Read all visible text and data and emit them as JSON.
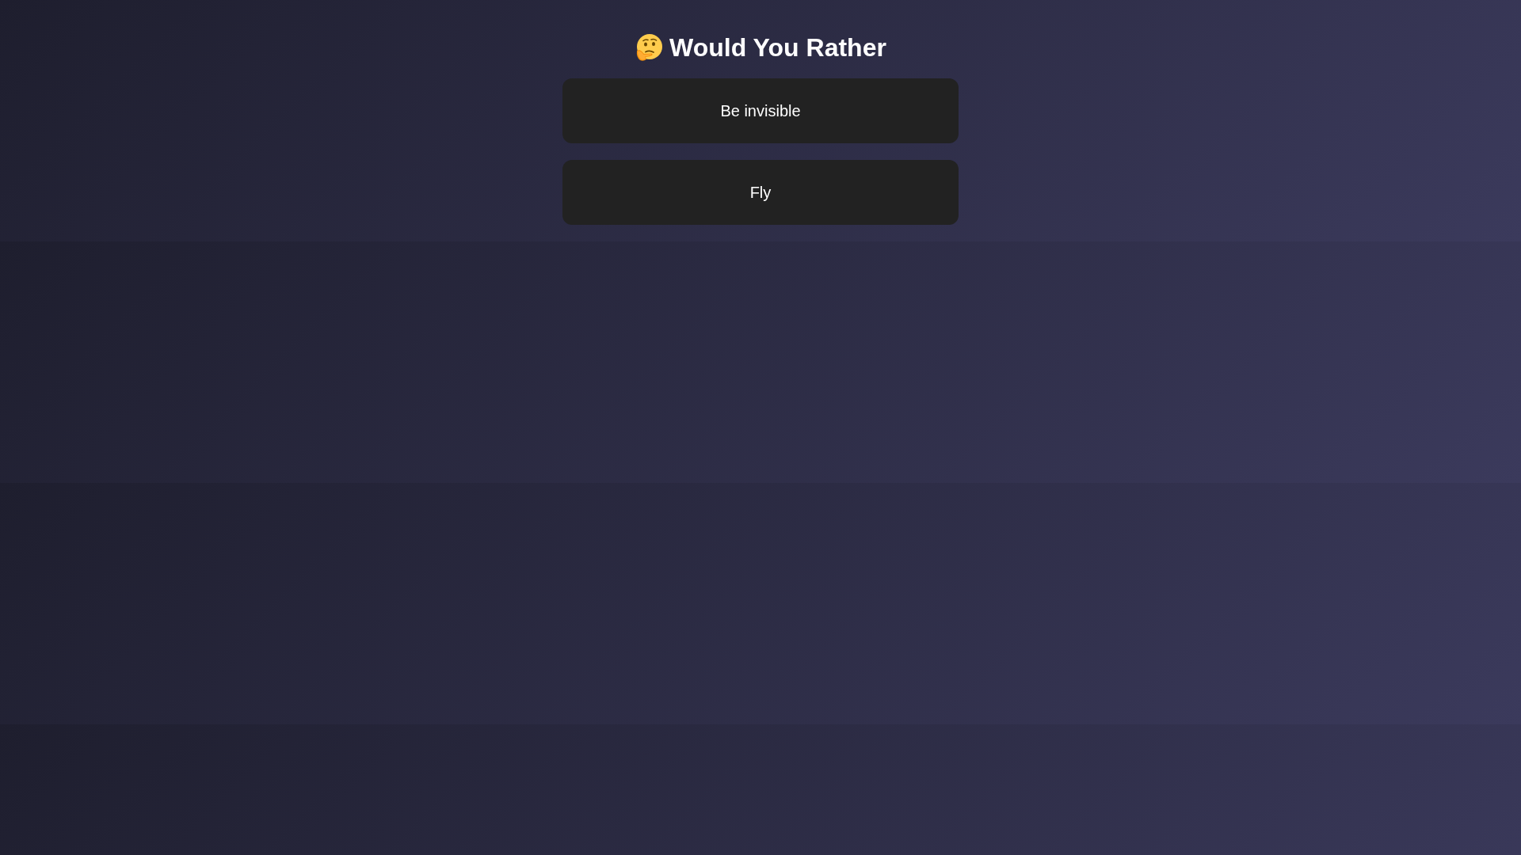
{
  "title": "Would You Rather",
  "options": [
    {
      "label": "Be invisible"
    },
    {
      "label": "Fly"
    }
  ]
}
